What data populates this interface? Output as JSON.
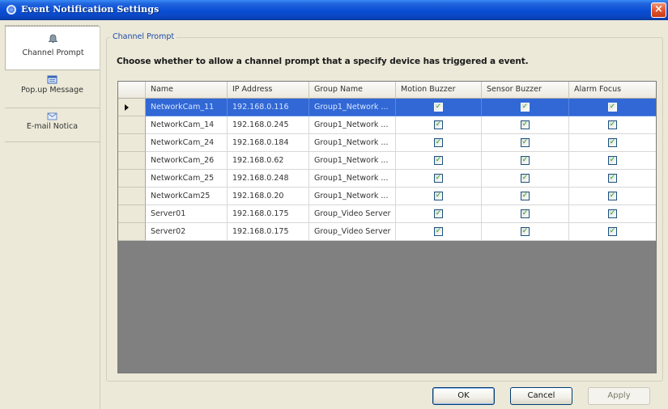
{
  "window": {
    "title": "Event Notification Settings",
    "close_label": "×",
    "accent": "#0A4FD6"
  },
  "nav": {
    "items": [
      {
        "label": "Channel Prompt",
        "icon": "bell-icon",
        "active": true
      },
      {
        "label": "Pop.up Message",
        "icon": "message-window-icon",
        "active": false
      },
      {
        "label": "E-mail Notica",
        "icon": "email-icon",
        "active": false
      }
    ]
  },
  "group": {
    "legend": "Channel Prompt",
    "instruction": "Choose whether to allow a channel prompt that a specify device has triggered a event."
  },
  "grid": {
    "columns": [
      "Name",
      "IP Address",
      "Group Name",
      "Motion Buzzer",
      "Sensor Buzzer",
      "Alarm Focus"
    ],
    "rows": [
      {
        "name": "NetworkCam_11",
        "ip": "192.168.0.116",
        "group": "Group1_Network ...",
        "motion": true,
        "sensor": true,
        "alarm": true,
        "selected": true
      },
      {
        "name": "NetworkCam_14",
        "ip": "192.168.0.245",
        "group": "Group1_Network ...",
        "motion": true,
        "sensor": true,
        "alarm": true,
        "selected": false
      },
      {
        "name": "NetworkCam_24",
        "ip": "192.168.0.184",
        "group": "Group1_Network ...",
        "motion": true,
        "sensor": true,
        "alarm": true,
        "selected": false
      },
      {
        "name": "NetworkCam_26",
        "ip": "192.168.0.62",
        "group": "Group1_Network ...",
        "motion": true,
        "sensor": true,
        "alarm": true,
        "selected": false
      },
      {
        "name": "NetworkCam_25",
        "ip": "192.168.0.248",
        "group": "Group1_Network ...",
        "motion": true,
        "sensor": true,
        "alarm": true,
        "selected": false
      },
      {
        "name": "NetworkCam25",
        "ip": "192.168.0.20",
        "group": "Group1_Network ...",
        "motion": true,
        "sensor": true,
        "alarm": true,
        "selected": false
      },
      {
        "name": "Server01",
        "ip": "192.168.0.175",
        "group": "Group_Video Server",
        "motion": true,
        "sensor": true,
        "alarm": true,
        "selected": false
      },
      {
        "name": "Server02",
        "ip": "192.168.0.175",
        "group": "Group_Video Server",
        "motion": true,
        "sensor": true,
        "alarm": true,
        "selected": false
      }
    ]
  },
  "buttons": {
    "ok": "OK",
    "cancel": "Cancel",
    "apply": "Apply"
  }
}
